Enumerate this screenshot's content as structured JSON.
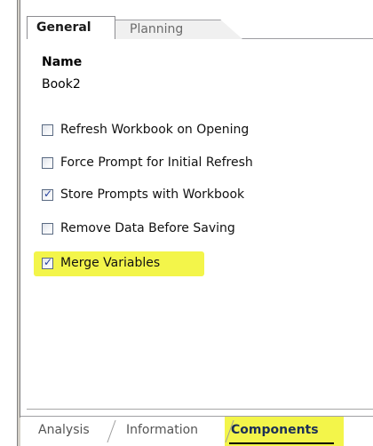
{
  "tabs": {
    "top": [
      "General",
      "Planning"
    ],
    "active_top": "General",
    "bottom": [
      "Analysis",
      "Information",
      "Components"
    ],
    "active_bottom": "Components"
  },
  "name": {
    "heading": "Name",
    "value": "Book2"
  },
  "options": [
    {
      "label": "Refresh Workbook on Opening",
      "checked": false
    },
    {
      "label": "Force Prompt for Initial Refresh",
      "checked": false
    },
    {
      "label": "Store Prompts with Workbook",
      "checked": true
    },
    {
      "label": "Remove Data Before Saving",
      "checked": false
    },
    {
      "label": "Merge Variables",
      "checked": true
    }
  ],
  "colors": {
    "highlight": "#f3f54a",
    "checkmark": "#24409c"
  }
}
